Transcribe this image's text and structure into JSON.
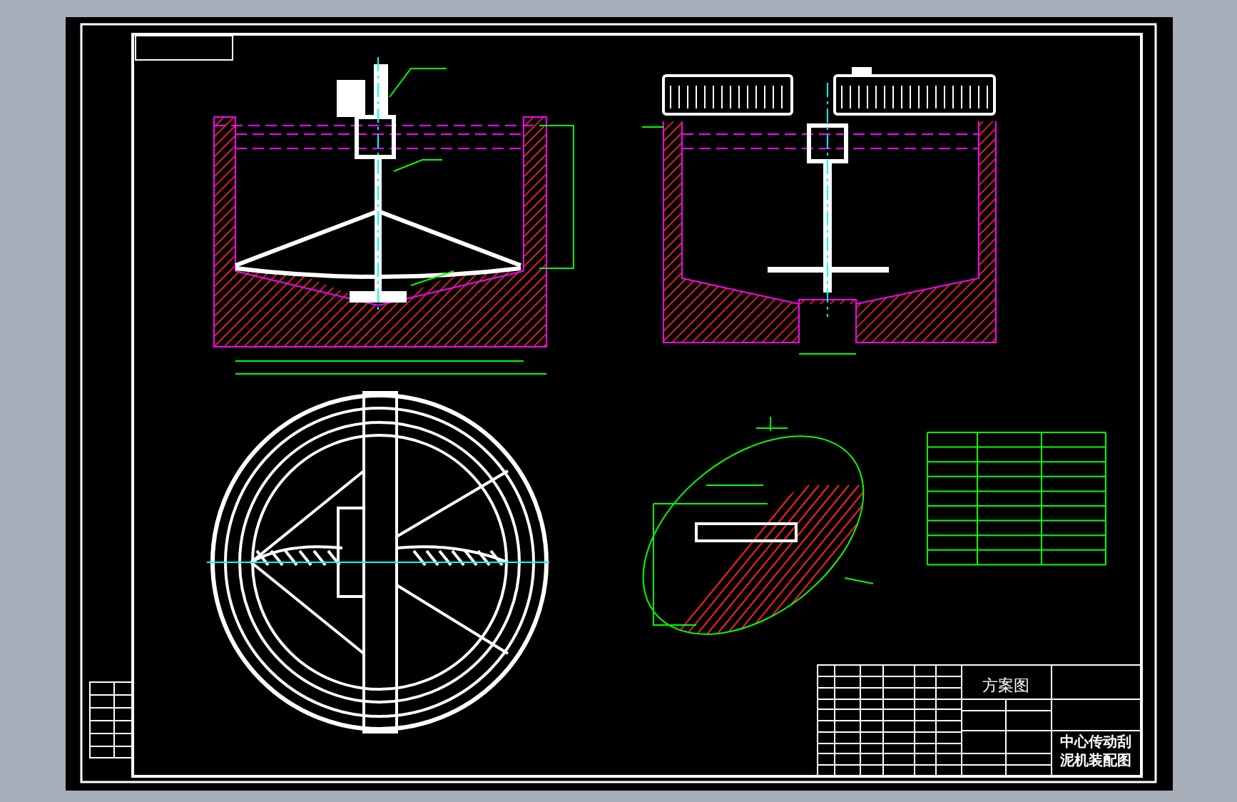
{
  "title_block": {
    "sheet_title": "方案图",
    "drawing_title": "中心传动刮泥机装配图"
  }
}
